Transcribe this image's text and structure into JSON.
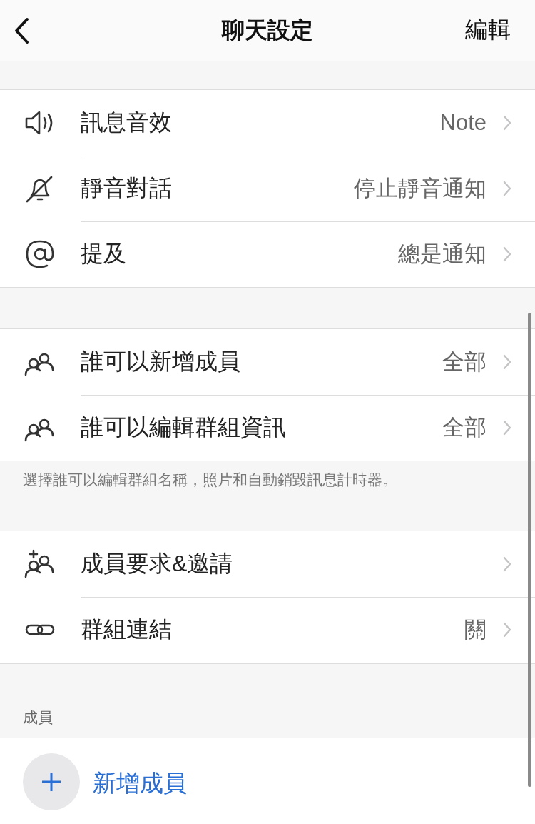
{
  "header": {
    "title": "聊天設定",
    "action": "編輯"
  },
  "sections": [
    {
      "rows": [
        {
          "kind": "speaker",
          "label": "訊息音效",
          "value": "Note"
        },
        {
          "kind": "mute",
          "label": "靜音對話",
          "value": "停止靜音通知"
        },
        {
          "kind": "mention",
          "label": "提及",
          "value": "總是通知"
        }
      ]
    },
    {
      "rows": [
        {
          "kind": "people",
          "label": "誰可以新增成員",
          "value": "全部"
        },
        {
          "kind": "people",
          "label": "誰可以編輯群組資訊",
          "value": "全部"
        }
      ],
      "footnote": "選擇誰可以編輯群組名稱，照片和自動銷毀訊息計時器。"
    },
    {
      "rows": [
        {
          "kind": "requests",
          "label": "成員要求&邀請"
        },
        {
          "kind": "link",
          "label": "群組連結",
          "value": "關"
        }
      ]
    }
  ],
  "members": {
    "heading": "成員",
    "add_label": "新增成員"
  }
}
